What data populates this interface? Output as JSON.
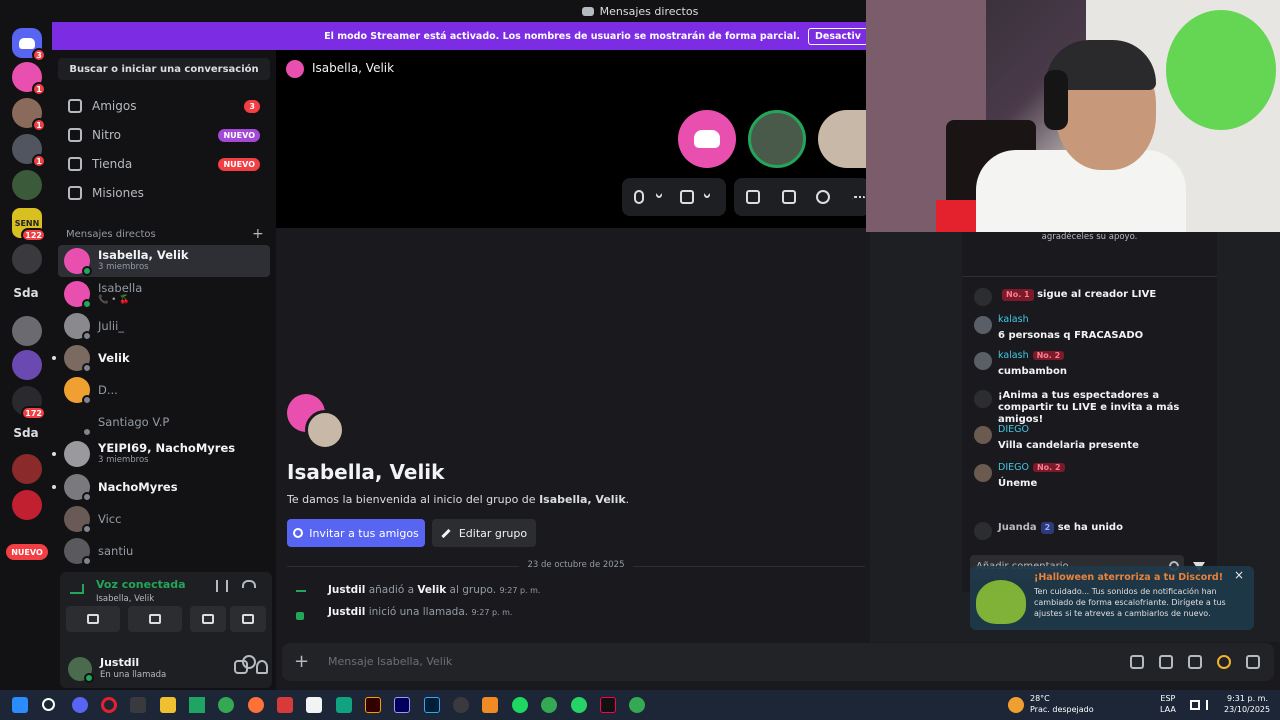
{
  "window": {
    "title": "Mensajes directos"
  },
  "banner": {
    "text": "El modo Streamer está activado. Los nombres de usuario se mostrarán de forma parcial.",
    "button": "Desactiv"
  },
  "rail": {
    "badges": [
      "3",
      "1",
      "1",
      "1",
      "122",
      "172"
    ],
    "labels": [
      "SENN",
      "Sda",
      "Sda"
    ],
    "nuevo": "NUEVO"
  },
  "sidebar": {
    "search_label": "Buscar o iniciar una conversación",
    "nav": [
      {
        "label": "Amigos",
        "badge": "3"
      },
      {
        "label": "Nitro",
        "badge": "NUEVO"
      },
      {
        "label": "Tienda",
        "badge": "NUEVO"
      },
      {
        "label": "Misiones",
        "badge": ""
      }
    ],
    "dm_header": "Mensajes directos",
    "dms": [
      {
        "name": "Isabella, Velik",
        "sub": "3 miembros"
      },
      {
        "name": "Isabella",
        "sub": "📞 • 🍒"
      },
      {
        "name": "Julii_",
        "sub": ""
      },
      {
        "name": "Velik",
        "sub": ""
      },
      {
        "name": "D...",
        "sub": ""
      },
      {
        "name": "Santiago V.P",
        "sub": ""
      },
      {
        "name": "YEIPI69, NachoMyres",
        "sub": "3 miembros"
      },
      {
        "name": "NachoMyres",
        "sub": ""
      },
      {
        "name": "Vicc",
        "sub": ""
      },
      {
        "name": "santiu",
        "sub": ""
      }
    ]
  },
  "voice": {
    "status": "Voz conectada",
    "channel": "Isabella, Velik"
  },
  "user": {
    "name": "Justdil",
    "status": "En una llamada"
  },
  "call": {
    "title": "Isabella, Velik"
  },
  "welcome": {
    "title": "Isabella, Velik",
    "subtitle_pre": "Te damos la bienvenida al inicio del grupo de ",
    "subtitle_bold": "Isabella, Velik",
    "subtitle_post": ".",
    "invite": "Invitar a tus amigos",
    "edit": "Editar grupo"
  },
  "messages": {
    "date": "23 de octubre de 2025",
    "items": [
      {
        "user": "Justdil",
        "mid": " añadió a ",
        "target": "Velik",
        "end": " al grupo. ",
        "time": "9:27 p. m."
      },
      {
        "user": "Justdil",
        "mid": " inició una llamada. ",
        "target": "",
        "end": "",
        "time": "9:27 p. m."
      }
    ]
  },
  "composer": {
    "placeholder": "Mensaje Isabella, Velik"
  },
  "live_chat": {
    "top_text": "agradéceles su apoyo.",
    "items": [
      {
        "name": "",
        "rank": "No. 1",
        "text": "sigue al creador LIVE"
      },
      {
        "name": "kalash",
        "rank": "",
        "text": "6 personas q FRACASADO"
      },
      {
        "name": "kalash",
        "rank": "No. 2",
        "text": "cumbambon"
      },
      {
        "name": "",
        "rank": "",
        "text": "¡Anima a tus espectadores a compartir tu LIVE e invita a más amigos!"
      },
      {
        "name": "DIEGO",
        "rank": "",
        "text": "Villa candelaria presente"
      },
      {
        "name": "DIEGO",
        "rank": "No. 2",
        "text": "Úneme"
      },
      {
        "name": "Juanda",
        "rank": "2",
        "text": "se ha unido"
      }
    ],
    "comment_placeholder": "Añadir comentario"
  },
  "notice": {
    "title": "¡Halloween aterroriza a tu Discord!",
    "text": "Ten cuidado... Tus sonidos de notificación han cambiado de forma escalofriante. Dirígete a tus ajustes si te atreves a cambiarlos de nuevo."
  },
  "taskbar": {
    "weather_temp": "28°C",
    "weather_desc": "Prac. despejado",
    "lang": "ESP",
    "lang2": "LAA",
    "time": "9:31 p. m.",
    "date": "23/10/2025"
  },
  "colors": {
    "accent": "#5865f2",
    "streamer": "#7c2ce3",
    "online": "#23a55a",
    "danger": "#f23f43"
  }
}
